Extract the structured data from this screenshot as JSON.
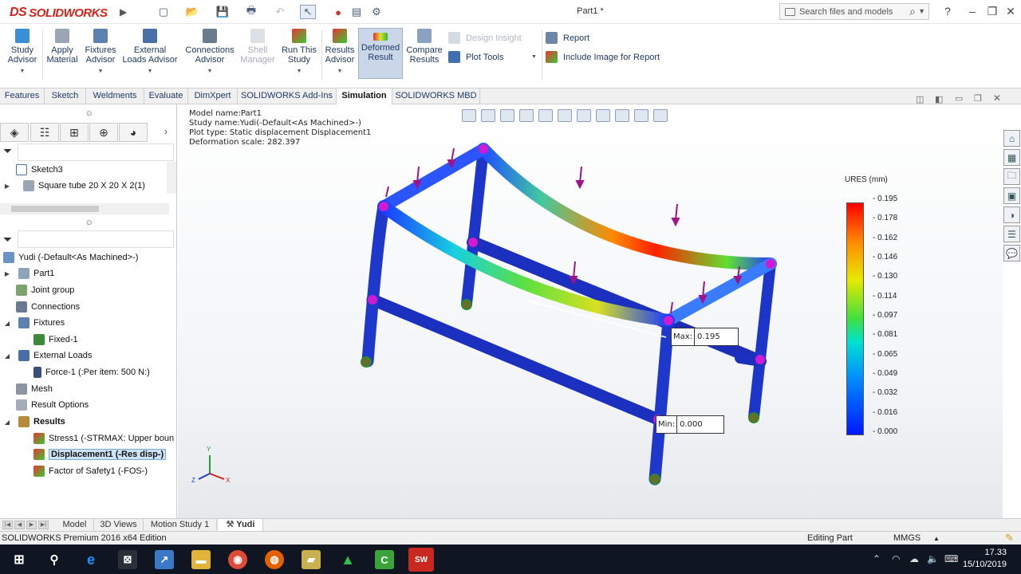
{
  "app": {
    "logo_text": "SOLIDWORKS",
    "logo_mark": "DS",
    "window_title": "Part1 *"
  },
  "search": {
    "placeholder": "Search files and models"
  },
  "commands": {
    "study_advisor": "Study Advisor",
    "apply_material": "Apply Material",
    "fixtures_advisor": "Fixtures Advisor",
    "external_loads_advisor": "External Loads Advisor",
    "connections_advisor": "Connections Advisor",
    "shell_manager": "Shell Manager",
    "run_this_study": "Run This Study",
    "results_advisor": "Results Advisor",
    "deformed_result": "Deformed Result",
    "compare_results": "Compare Results",
    "design_insight": "Design Insight",
    "plot_tools": "Plot Tools",
    "report": "Report",
    "include_image": "Include Image for Report"
  },
  "tabs": [
    "Features",
    "Sketch",
    "Weldments",
    "Evaluate",
    "DimXpert",
    "SOLIDWORKS Add-Ins",
    "Simulation",
    "SOLIDWORKS MBD"
  ],
  "active_tab": "Simulation",
  "feature_tree": {
    "top_items": [
      "Sketch3",
      "Square tube 20 X 20 X 2(1)"
    ],
    "study": "Yudi (-Default<As Machined>-)",
    "items": [
      {
        "label": "Part1"
      },
      {
        "label": "Joint group"
      },
      {
        "label": "Connections"
      },
      {
        "label": "Fixtures"
      },
      {
        "label": "Fixed-1"
      },
      {
        "label": "External Loads"
      },
      {
        "label": "Force-1 (:Per item: 500 N:)"
      },
      {
        "label": "Mesh"
      },
      {
        "label": "Result Options"
      },
      {
        "label": "Results"
      },
      {
        "label": "Stress1 (-STRMAX: Upper boun"
      },
      {
        "label": "Displacement1 (-Res disp-)"
      },
      {
        "label": "Factor of Safety1 (-FOS-)"
      }
    ]
  },
  "study_info": {
    "model": "Model name:Part1",
    "study": "Study name:Yudi(-Default<As Machined>-)",
    "plot": "Plot type: Static displacement Displacement1",
    "scale": "Deformation scale: 282.397"
  },
  "legend": {
    "title": "URES (mm)",
    "labels": [
      "0.195",
      "0.178",
      "0.162",
      "0.146",
      "0.130",
      "0.114",
      "0.097",
      "0.081",
      "0.065",
      "0.049",
      "0.032",
      "0.016",
      "0.000"
    ]
  },
  "probes": {
    "max_key": "Max:",
    "max_val": "0.195",
    "min_key": "Min:",
    "min_val": "0.000"
  },
  "triad": {
    "x": "X",
    "y": "Y",
    "z": "Z"
  },
  "bottom_tabs": [
    "Model",
    "3D Views",
    "Motion Study 1",
    "Yudi"
  ],
  "status": {
    "edition": "SOLIDWORKS Premium 2016 x64 Edition",
    "mode": "Editing Part",
    "units": "MMGS"
  },
  "taskbar": {
    "time": "17.33",
    "date": "15/10/2019"
  },
  "colors": {
    "accent_red": "#d0241a",
    "brand_blue": "#1f3a66"
  }
}
